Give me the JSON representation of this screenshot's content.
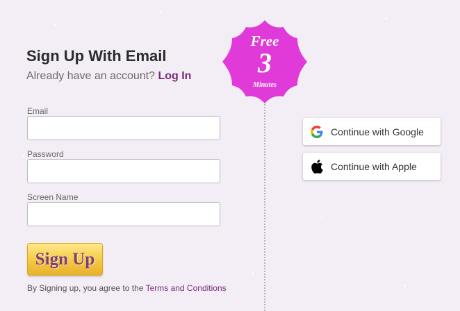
{
  "form": {
    "title": "Sign Up With Email",
    "subtitle_prefix": "Already have an account? ",
    "login_link": "Log In",
    "email_label": "Email",
    "email_value": "",
    "password_label": "Password",
    "password_value": "",
    "screen_name_label": "Screen Name",
    "screen_name_value": "",
    "signup_button": "Sign Up",
    "terms_prefix": "By Signing up, you agree to the ",
    "terms_link": "Terms and Conditions"
  },
  "badge": {
    "free": "Free",
    "number": "3",
    "minutes": "Minutes",
    "color": "#e03ad8"
  },
  "social": {
    "google_label": "Continue with Google",
    "google_icon": "google-icon",
    "apple_label": "Continue with Apple",
    "apple_icon": "apple-icon"
  },
  "colors": {
    "background": "#f3edf6",
    "accent": "#7a2a7e",
    "button_gold": "#f5c842"
  }
}
